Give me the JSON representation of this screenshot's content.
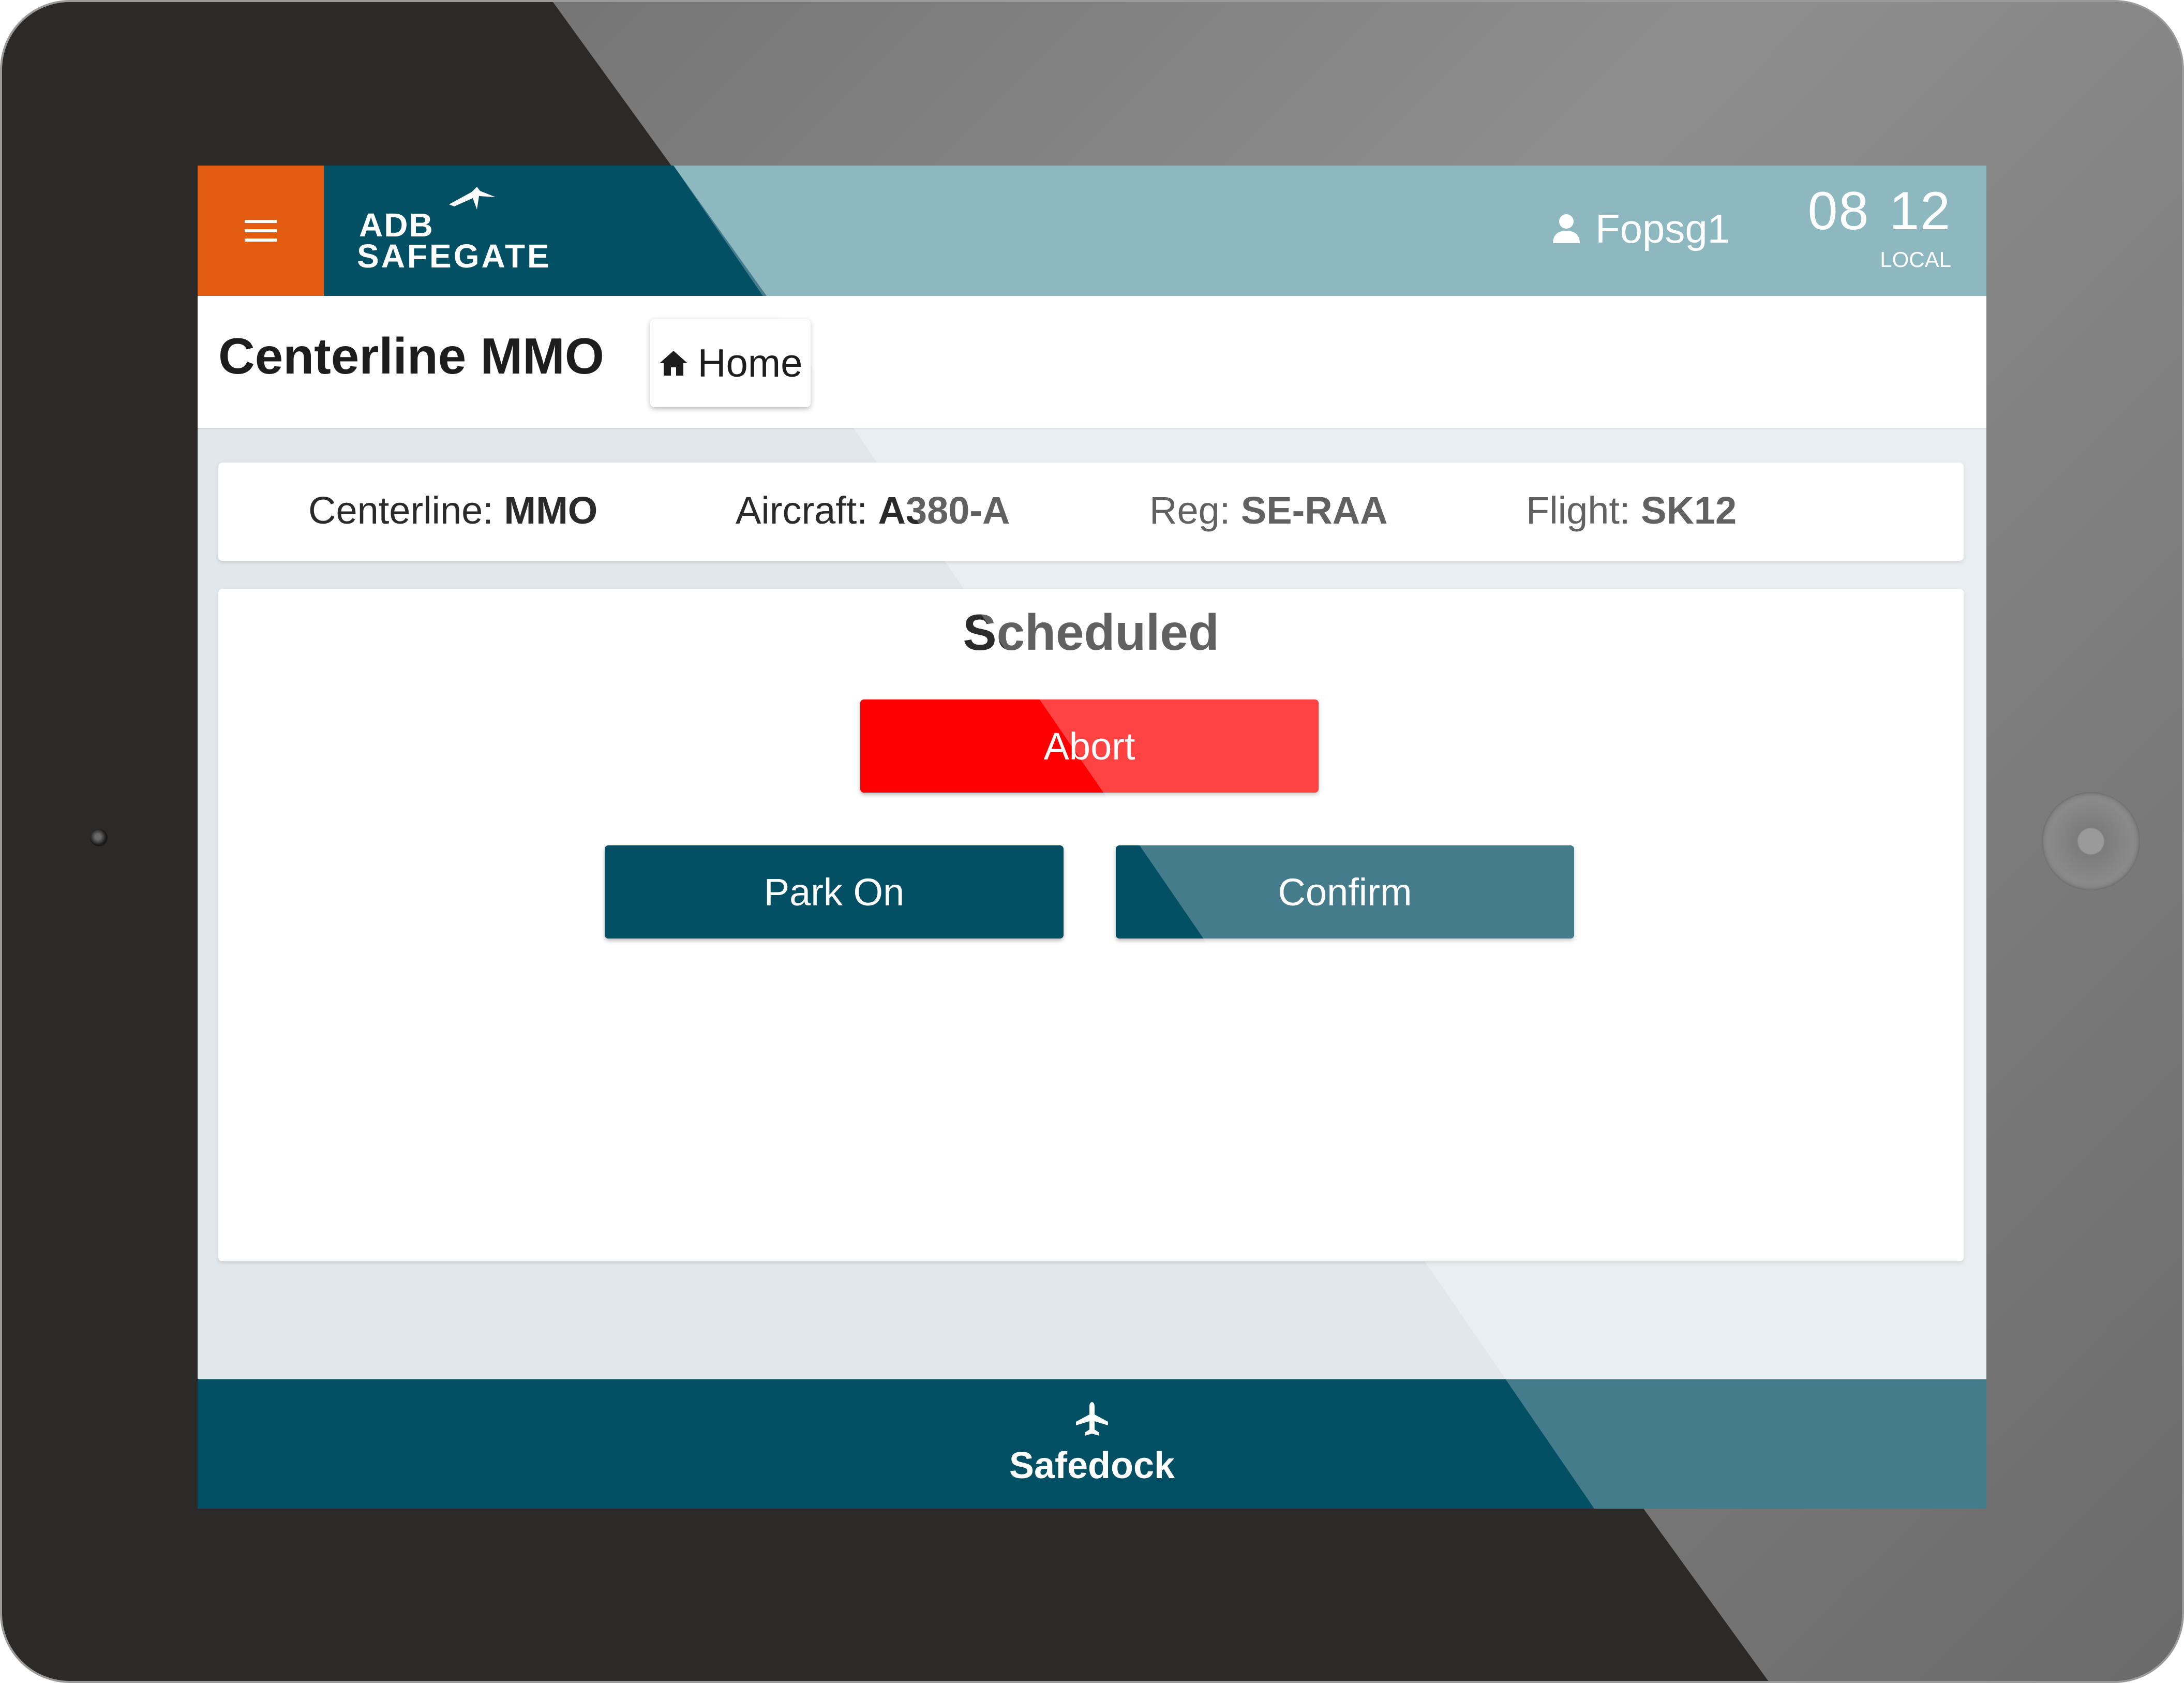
{
  "app": {
    "brand_line1": "ADB",
    "brand_line2": "SAFEGATE",
    "menu_icon": "hamburger-menu-icon",
    "user_icon": "person-icon",
    "user_name": "Fopsg1",
    "time_hours": "08",
    "time_minutes": "12",
    "time_zone": "LOCAL"
  },
  "header": {
    "title": "Centerline MMO",
    "home_label": "Home",
    "home_icon": "home-icon"
  },
  "info": {
    "centerline_label": "Centerline: ",
    "centerline_value": "MMO",
    "aircraft_label": "Aircraft: ",
    "aircraft_value": "A380-A",
    "reg_label": "Reg: ",
    "reg_value": "SE-RAA",
    "flight_label": "Flight: ",
    "flight_value": "SK12"
  },
  "status": {
    "title": "Scheduled",
    "abort_label": "Abort",
    "park_on_label": "Park On",
    "confirm_label": "Confirm"
  },
  "footer": {
    "icon": "airplane-icon",
    "label": "Safedock"
  },
  "colors": {
    "brand_dark": "#034f64",
    "brand_light": "#66a0ab",
    "menu_orange": "#e45b12",
    "abort_red": "#ff0000",
    "background": "#e1e8ec"
  }
}
